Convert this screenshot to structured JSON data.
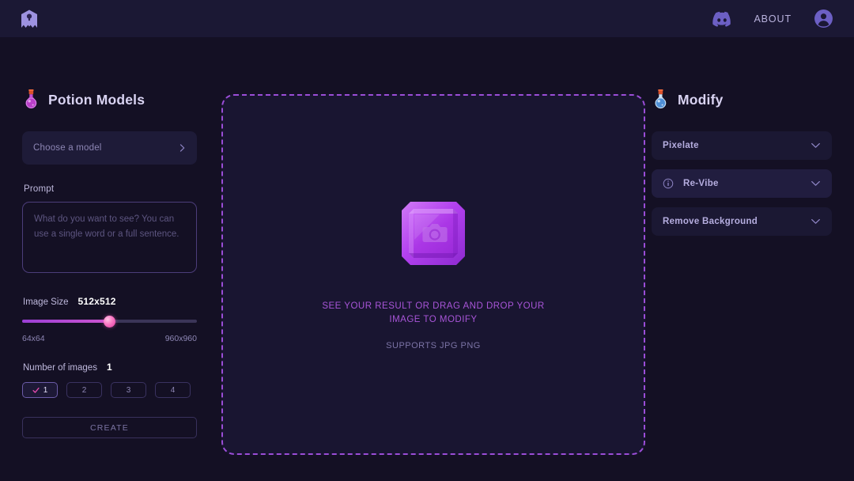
{
  "header": {
    "logo_name": "ghost-logo",
    "discord_label": "discord-icon",
    "about_label": "ABOUT",
    "avatar_label": "account-icon"
  },
  "left": {
    "title": "Potion Models",
    "model_select": {
      "placeholder": "Choose a model",
      "value": ""
    },
    "prompt": {
      "label": "Prompt",
      "placeholder": "What do you want to see? You can use a single word or a full sentence.",
      "value": ""
    },
    "image_size": {
      "label": "Image Size",
      "value": "512x512",
      "min_label": "64x64",
      "max_label": "960x960",
      "percent": 50
    },
    "number_of_images": {
      "label": "Number of images",
      "value": "1",
      "options": [
        "1",
        "2",
        "3",
        "4"
      ],
      "selected_index": 0
    },
    "create_label": "CREATE"
  },
  "dropzone": {
    "main_text": "SEE YOUR RESULT OR DRAG AND DROP YOUR IMAGE TO MODIFY",
    "sub_text": "SUPPORTS JPG PNG",
    "icon_name": "gem-camera-icon"
  },
  "right": {
    "title": "Modify",
    "items": [
      {
        "label": "Pixelate",
        "has_info": false,
        "highlight": false
      },
      {
        "label": "Re-Vibe",
        "has_info": true,
        "highlight": true
      },
      {
        "label": "Remove Background",
        "has_info": false,
        "highlight": false
      }
    ]
  },
  "colors": {
    "page_bg": "#141024",
    "header_bg": "#1b1834",
    "card_bg": "#1e1b38",
    "accent_purple": "#9b4dd8",
    "accent_pink": "#e0399f",
    "text_primary": "#d9d3f2",
    "text_muted": "#8d86b4"
  }
}
